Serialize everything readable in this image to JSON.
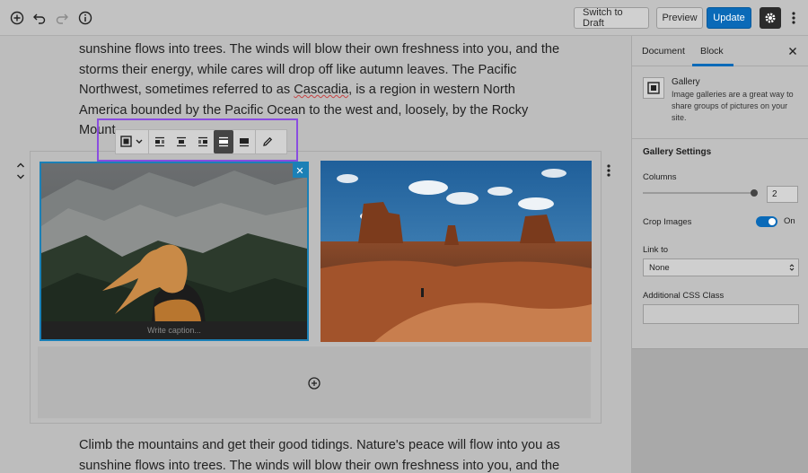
{
  "toolbar": {
    "switch_to_draft": "Switch to Draft",
    "preview": "Preview",
    "update": "Update",
    "icons": [
      "add-block-icon",
      "undo-icon",
      "redo-icon",
      "info-icon",
      "gear-icon",
      "more-vertical-icon"
    ]
  },
  "content": {
    "para_top_1": "sunshine flows into trees. The winds will blow their own freshness into you, and the",
    "para_top_2": "storms their energy, while cares will drop off like autumn leaves. The Pacific",
    "para_top_3a": "Northwest, sometimes referred to as ",
    "para_top_3b": "Cascadia",
    "para_top_3c": ", is a region in western North",
    "para_top_4": "America bounded by the Pacific Ocean to the west and, loosely, by the Rocky",
    "para_top_5": "Mount",
    "para_bottom_1": "Climb the mountains and get their good tidings. Nature's peace will flow into you as",
    "para_bottom_2": "sunshine flows into trees. The winds will blow their own freshness into you, and the"
  },
  "gallery": {
    "caption_placeholder": "Write caption...",
    "remove_label": "✕"
  },
  "sidebar": {
    "tab_document": "Document",
    "tab_block": "Block",
    "block_title": "Gallery",
    "block_desc": "Image galleries are a great way to share groups of pictures on your site.",
    "settings_title": "Gallery Settings",
    "columns_label": "Columns",
    "columns_value": "2",
    "crop_label": "Crop Images",
    "crop_state": "On",
    "link_label": "Link to",
    "link_value": "None",
    "css_label": "Additional CSS Class",
    "accent": "#0a6ab8"
  }
}
